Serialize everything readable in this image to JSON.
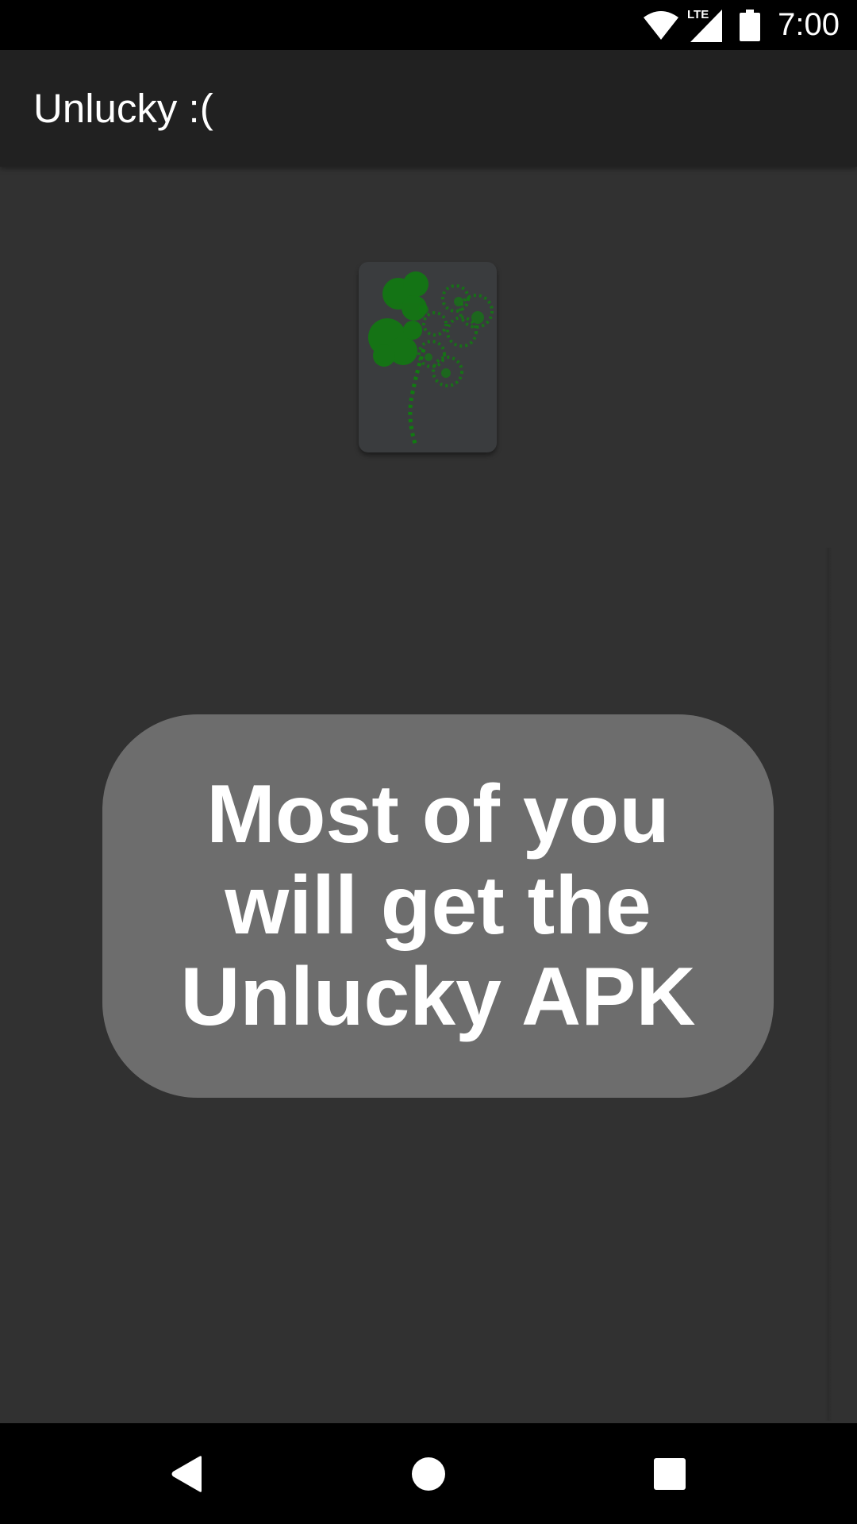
{
  "status_bar": {
    "time": "7:00",
    "network_label": "LTE",
    "icons": [
      "wifi-icon",
      "lte-signal-icon",
      "battery-icon"
    ]
  },
  "app_bar": {
    "title": "Unlucky :("
  },
  "content": {
    "image_icon": "four-leaf-clover",
    "message": "Most of you\nwill get the\nUnlucky APK"
  },
  "nav_bar": {
    "icons": [
      "back-icon",
      "home-icon",
      "recents-icon"
    ]
  },
  "colors": {
    "status_bar_bg": "#000000",
    "app_bar_bg": "#212121",
    "content_bg": "#313131",
    "card_bg": "#3a3c3e",
    "bubble_bg": "#6d6d6d",
    "clover_green": "#117a11",
    "text": "#ffffff"
  }
}
